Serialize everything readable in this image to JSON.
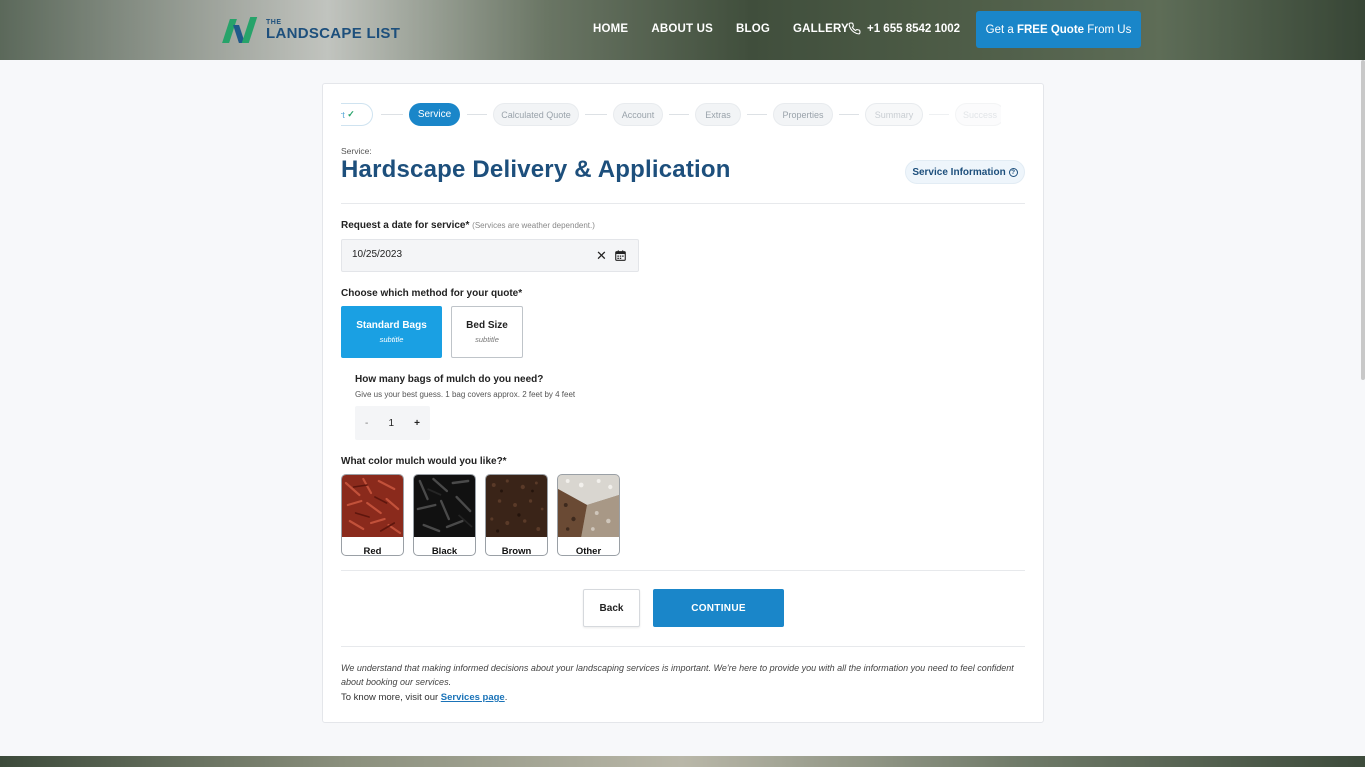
{
  "header": {
    "logo_small": "THE",
    "logo_main": "LANDSCAPE LIST",
    "nav": [
      "HOME",
      "ABOUT US",
      "BLOG",
      "GALLERY"
    ],
    "phone": "+1 655 8542 1002",
    "quote_pre": "Get a ",
    "quote_bold": "FREE Quote",
    "quote_post": " From Us"
  },
  "stepper": {
    "steps": [
      "rt",
      "Service",
      "Calculated Quote",
      "Account",
      "Extras",
      "Properties",
      "Summary",
      "Success"
    ],
    "check": "✓"
  },
  "service": {
    "label": "Service:",
    "title": "Hardscape Delivery & Application",
    "info_button": "Service Information",
    "info_icon": "?"
  },
  "date": {
    "label": "Request a date for service*",
    "note": "(Services are weather dependent.)",
    "value": "10/25/2023",
    "clear": "✕"
  },
  "method": {
    "label": "Choose which method for your quote*",
    "options": [
      {
        "title": "Standard Bags",
        "subtitle": "subtitle"
      },
      {
        "title": "Bed Size",
        "subtitle": "subtitle"
      }
    ]
  },
  "bags": {
    "question": "How many bags of mulch do you need?",
    "hint": "Give us your best guess. 1 bag covers approx. 2 feet by 4 feet",
    "minus": "-",
    "value": "1",
    "plus": "+"
  },
  "color": {
    "label": "What color mulch would you like?*",
    "options": [
      "Red",
      "Black",
      "Brown",
      "Other"
    ]
  },
  "actions": {
    "back": "Back",
    "continue": "CONTINUE"
  },
  "footer": {
    "note": "We understand that making informed decisions about your landscaping services is important. We're here to provide you with all the information you need to feel confident about booking our services.",
    "more_pre": "To know more, visit our ",
    "more_link": "Services page",
    "more_post": "."
  },
  "colors": {
    "brand_blue": "#1a86c9",
    "title_blue": "#1d4f7c",
    "selected_blue": "#1aa0e3",
    "logo_green": "#27a36a"
  }
}
